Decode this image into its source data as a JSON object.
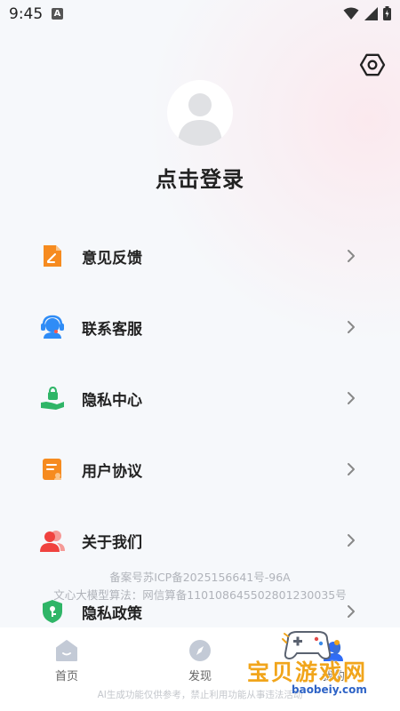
{
  "status_bar": {
    "time": "9:45",
    "notification_glyph": "A",
    "icons": [
      "wifi-icon",
      "signal-icon",
      "battery-icon"
    ]
  },
  "header": {
    "settings_icon": "settings-icon"
  },
  "profile": {
    "login_label": "点击登录",
    "avatar_icon": "user-avatar-icon"
  },
  "menu": {
    "items": [
      {
        "label": "意见反馈",
        "icon": "feedback-doc-icon",
        "color": "#f68b1f"
      },
      {
        "label": "联系客服",
        "icon": "customer-service-headset-icon",
        "color": "#2f8cf6"
      },
      {
        "label": "隐私中心",
        "icon": "privacy-lock-hand-icon",
        "color": "#2fb567"
      },
      {
        "label": "用户协议",
        "icon": "user-agreement-doc-icon",
        "color": "#f68b1f"
      },
      {
        "label": "关于我们",
        "icon": "about-us-people-icon",
        "color": "#f0423f"
      },
      {
        "label": "隐私政策",
        "icon": "privacy-policy-shield-icon",
        "color": "#2fb567"
      }
    ]
  },
  "footer": {
    "icp": "备案号苏ICP备2025156641号-96A",
    "algorithm": "文心大模型算法：网信算备110108645502801230035号",
    "ai_disclaimer": "AI生成功能仅供参考，禁止利用功能从事违法活动"
  },
  "bottom_nav": {
    "items": [
      {
        "label": "首页",
        "icon": "home-icon"
      },
      {
        "label": "发现",
        "icon": "compass-icon"
      },
      {
        "label": "我的",
        "icon": "profile-icon"
      }
    ]
  },
  "watermark": {
    "title": "宝贝游戏网",
    "url": "baobeiy.com"
  }
}
